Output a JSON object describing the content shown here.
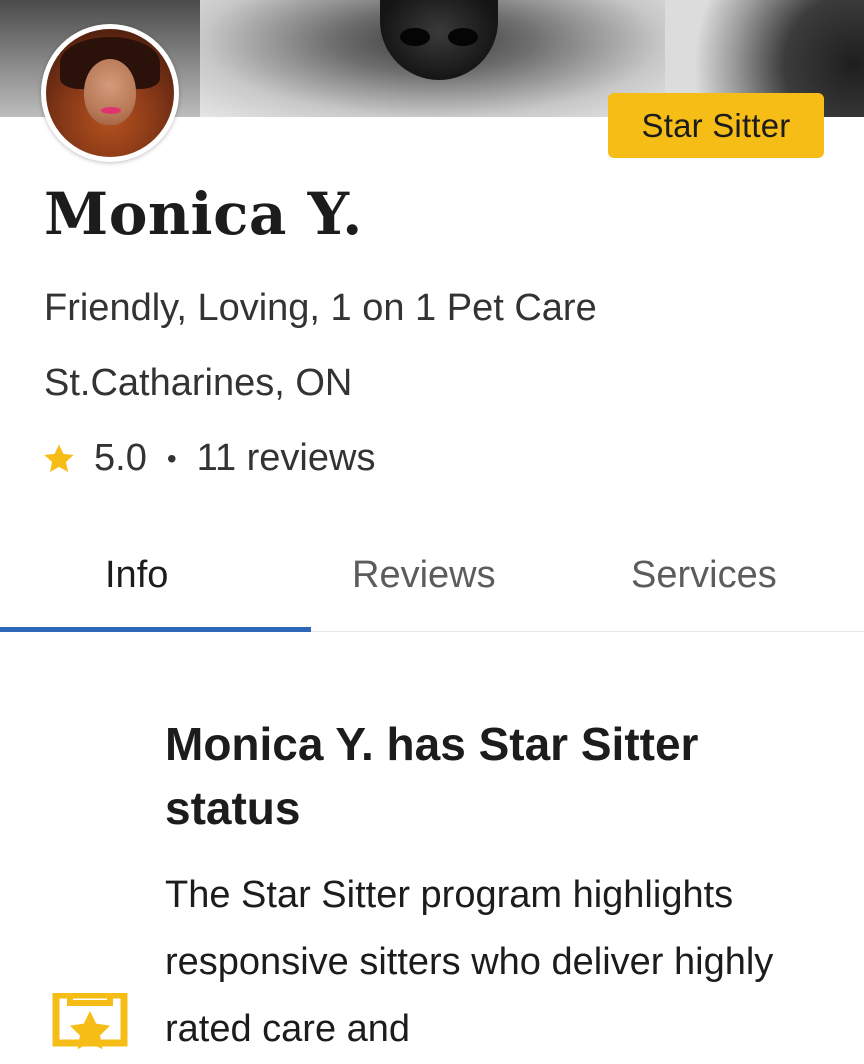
{
  "cover": {
    "image": "cover-photo-dog"
  },
  "profile": {
    "avatar": "profile-photo",
    "badge_label": "Star Sitter",
    "name": "Monica Y.",
    "tagline": "Friendly, Loving, 1 on 1 Pet Care",
    "location": "St.Catharines, ON",
    "rating": "5.0",
    "rating_separator": "•",
    "reviews_count": "11 reviews"
  },
  "tabs": [
    {
      "label": "Info",
      "active": true
    },
    {
      "label": "Reviews",
      "active": false
    },
    {
      "label": "Services",
      "active": false
    }
  ],
  "star_sitter_section": {
    "title": "Monica Y. has Star Sitter status",
    "body": "The Star Sitter program highlights responsive sitters who deliver highly rated care and",
    "icon": "star-sitter-badge-icon"
  },
  "colors": {
    "badge": "#f6bd16",
    "star": "#f6bd16",
    "tab_indicator": "#2e67b8",
    "text_primary": "#1c1c1c",
    "text_secondary": "#5c5c5c"
  }
}
